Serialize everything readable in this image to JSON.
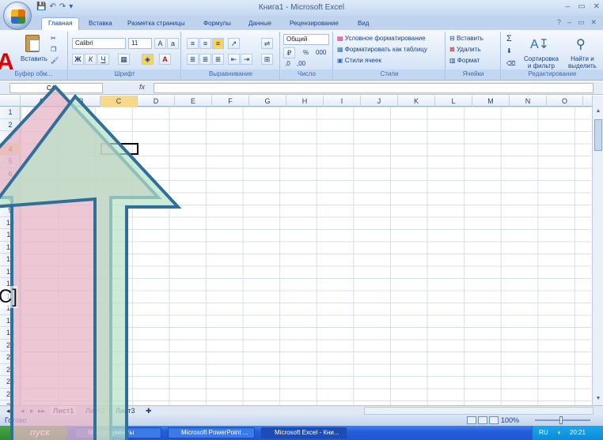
{
  "window": {
    "title": "Книга1 - Microsoft Excel"
  },
  "qat": [
    "💾",
    "↶",
    "↷",
    "▾"
  ],
  "window_controls": [
    "–",
    "▭",
    "✕"
  ],
  "tabs": [
    "Главная",
    "Вставка",
    "Разметка страницы",
    "Формулы",
    "Данные",
    "Рецензирование",
    "Вид"
  ],
  "ribbon": {
    "clipboard": {
      "label": "Буфер обм...",
      "paste": "Вставить"
    },
    "font": {
      "label": "Шрифт",
      "name": "Calibri",
      "size": "11",
      "bold": "Ж",
      "italic": "К",
      "underline": "Ч"
    },
    "alignment": {
      "label": "Выравнивание"
    },
    "number": {
      "label": "Число",
      "format": "Общий",
      "percent": "%",
      "thousands": "000",
      "inc": ",0",
      "dec": ",00"
    },
    "styles": {
      "label": "Стили",
      "conditional": "Условное форматирование",
      "table": "Форматировать как таблицу",
      "cell_styles": "Стили ячеек"
    },
    "cells": {
      "label": "Ячейки",
      "insert": "Вставить",
      "delete": "Удалить",
      "format": "Формат"
    },
    "editing": {
      "label": "Редактирование",
      "sum": "Σ",
      "sort_line1": "Сортировка",
      "sort_line2": "и фильтр",
      "find_line1": "Найти и",
      "find_line2": "выделить"
    }
  },
  "formula_bar": {
    "name_box": "C4",
    "fx": "fx"
  },
  "columns": [
    "A",
    "B",
    "C",
    "D",
    "E",
    "F",
    "G",
    "H",
    "I",
    "J",
    "K",
    "L",
    "M",
    "N",
    "O"
  ],
  "rows": [
    "1",
    "2",
    "3",
    "4",
    "5",
    "6",
    "7",
    "8",
    "9",
    "10",
    "11",
    "12",
    "13",
    "14",
    "15",
    "16",
    "17",
    "18",
    "19",
    "20",
    "21",
    "22",
    "23",
    "24",
    "25"
  ],
  "sheets": [
    "Лист1",
    "Лист2",
    "Лист3"
  ],
  "status": {
    "ready": "Готово",
    "zoom": "100%"
  },
  "taskbar": {
    "start": "пуск",
    "items": [
      "Мои документы",
      "Microsoft PowerPoint ...",
      "Microsoft Excel - Кни..."
    ],
    "lang": "RU",
    "time": "20:21"
  },
  "overlay": {
    "big_letter": "А",
    "side_text": "С]"
  },
  "colors": {
    "arrow_left_fill": "#e7b6c6",
    "arrow_right_fill": "#b6e2c6",
    "arrow_stroke": "#2f6f99",
    "accent": "#15428b"
  }
}
